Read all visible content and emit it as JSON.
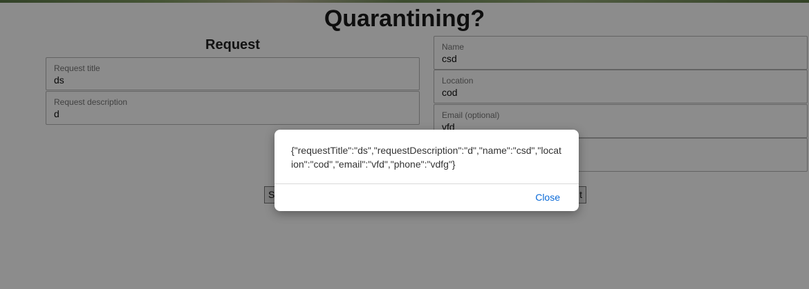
{
  "page": {
    "title": "Quarantining?"
  },
  "request": {
    "heading": "Request",
    "title_label": "Request title",
    "title_value": "ds",
    "description_label": "Request description",
    "description_value": "d"
  },
  "contact": {
    "name_label": "Name",
    "name_value": "csd",
    "location_label": "Location",
    "location_value": "cod",
    "email_label": "Email (optional)",
    "email_value": "vfd"
  },
  "buttons": {
    "left_partial": "S",
    "right_partial": "t"
  },
  "dialog": {
    "message": "{\"requestTitle\":\"ds\",\"requestDescription\":\"d\",\"name\":\"csd\",\"location\":\"cod\",\"email\":\"vfd\",\"phone\":\"vdfg\"}",
    "close_label": "Close",
    "link_color": "#0a6ad8"
  }
}
